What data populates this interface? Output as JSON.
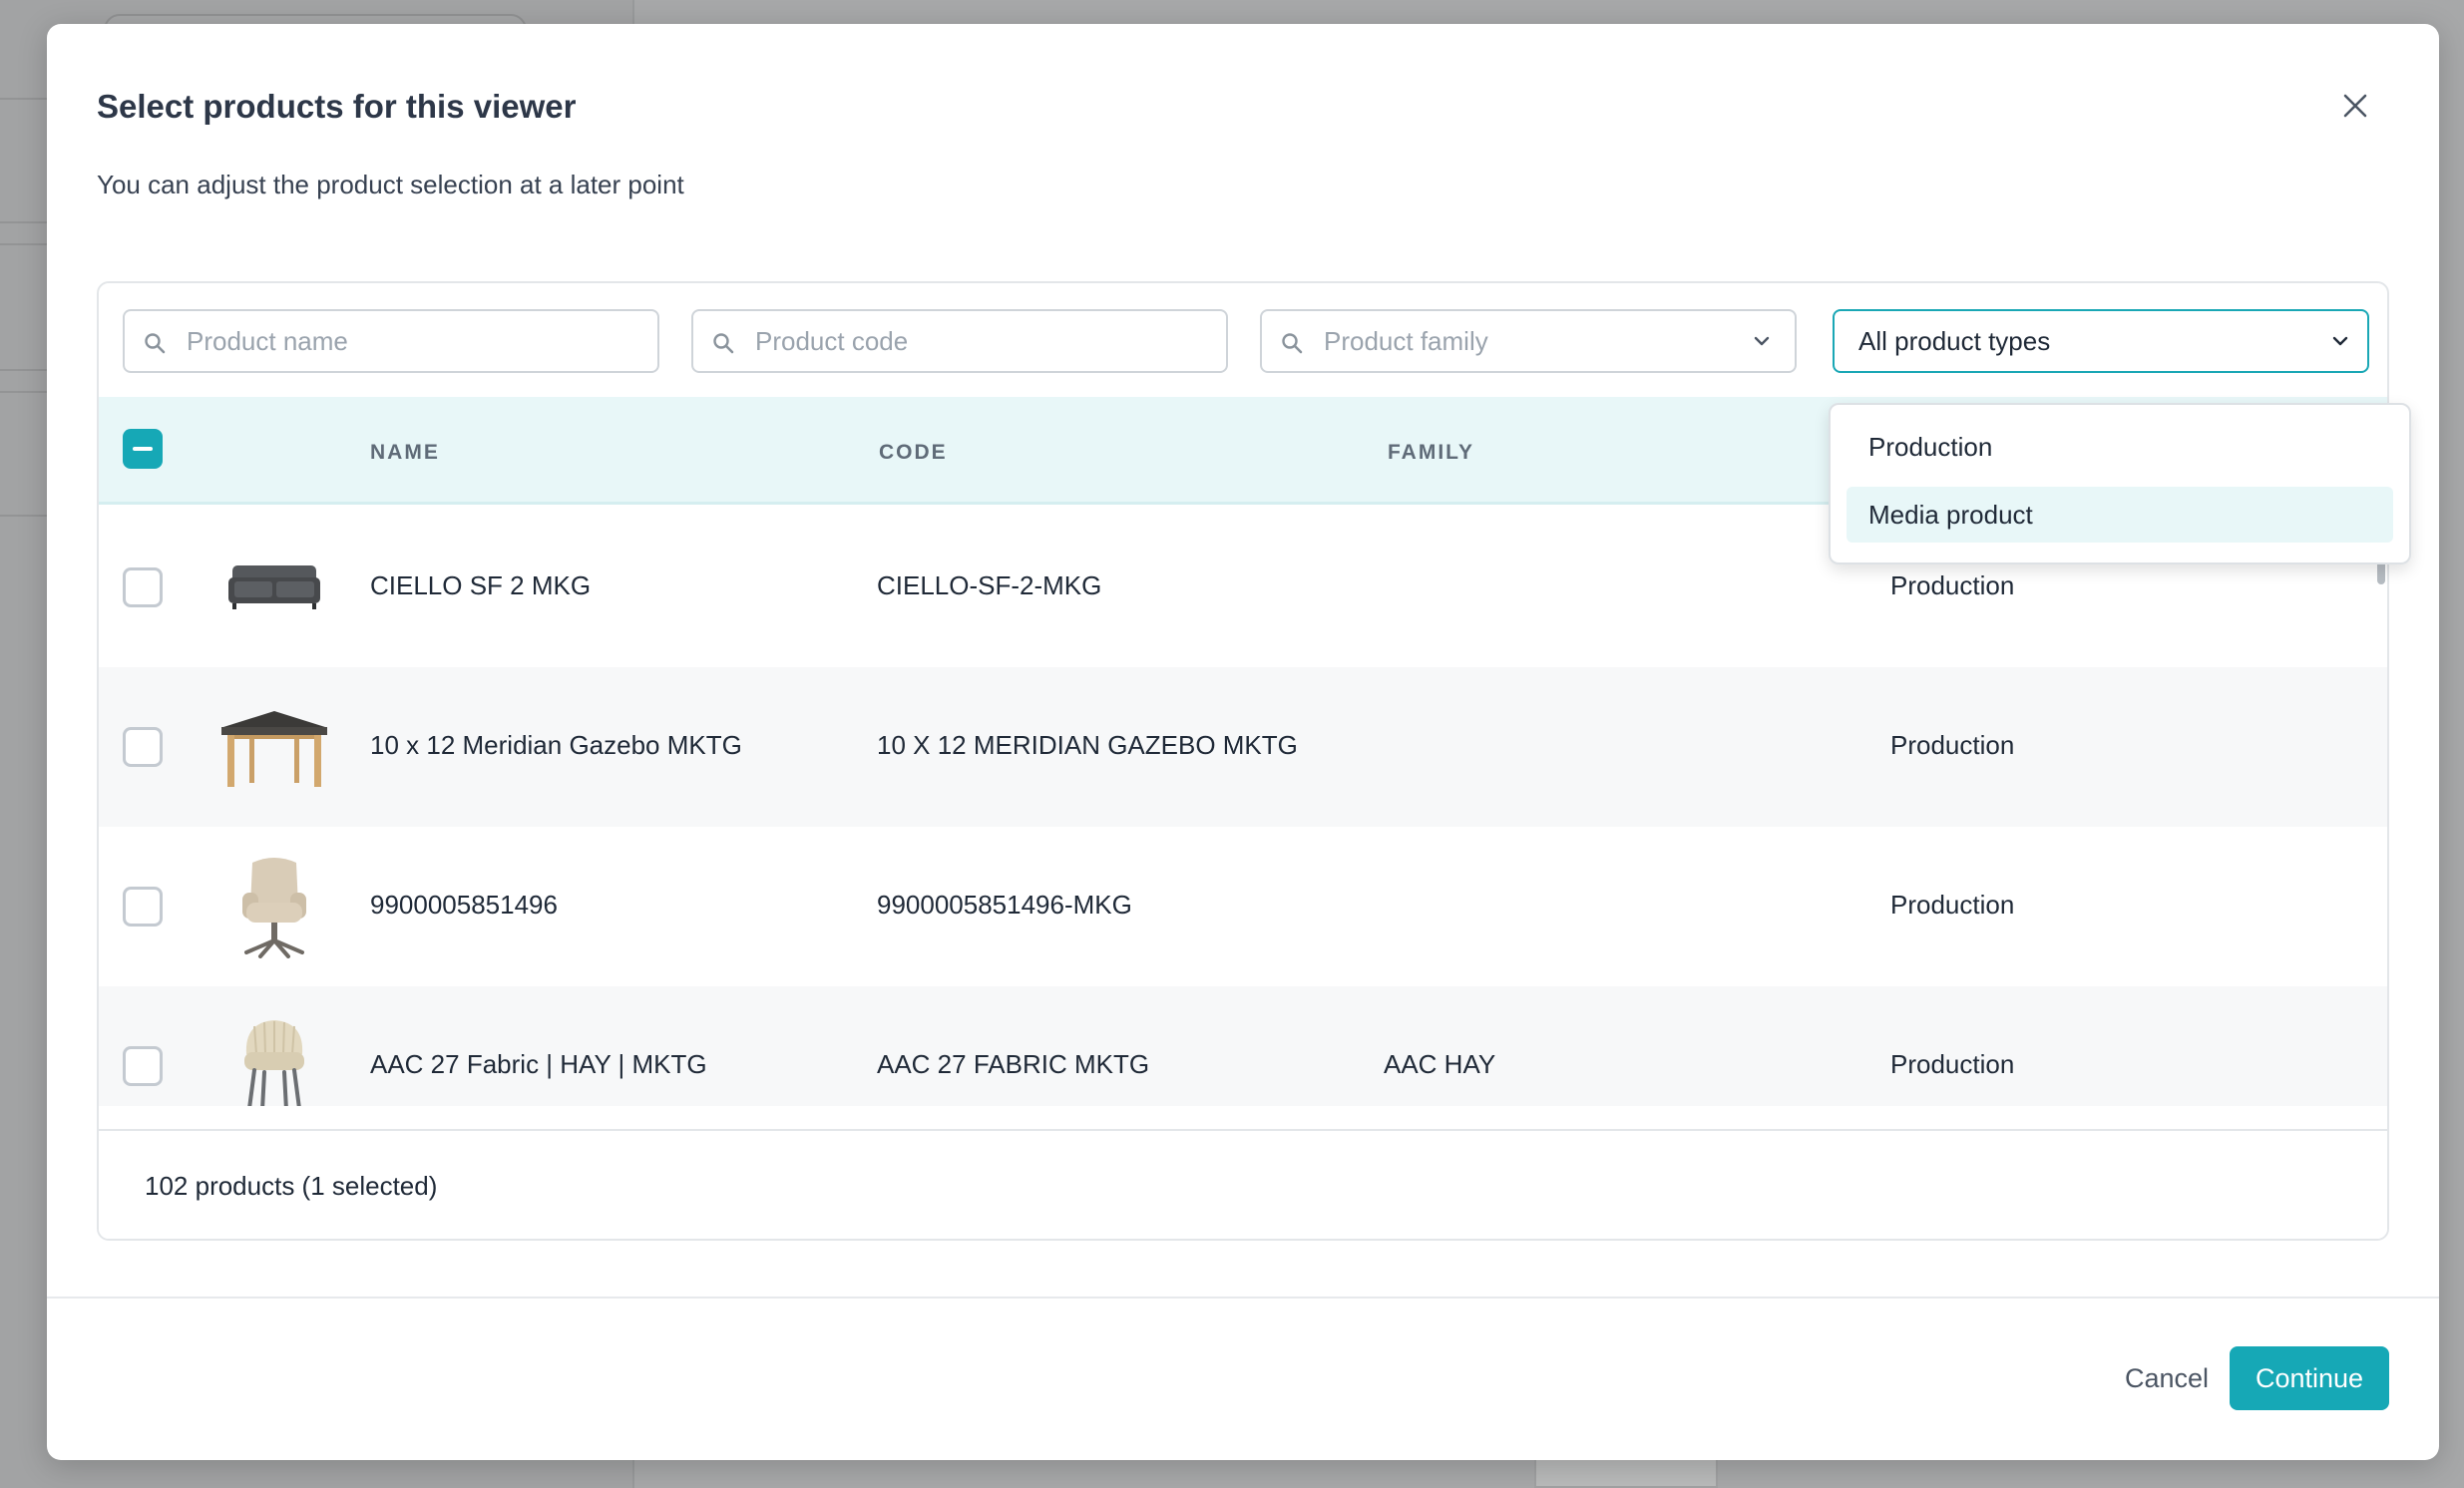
{
  "dialog": {
    "title": "Select products for this viewer",
    "subtitle": "You can adjust the product selection at a later point"
  },
  "filters": {
    "product_name_placeholder": "Product name",
    "product_code_placeholder": "Product code",
    "product_family_placeholder": "Product family",
    "product_type_selected": "All product types"
  },
  "type_menu": {
    "options": [
      "Production",
      "Media product"
    ],
    "highlighted": "Media product"
  },
  "table": {
    "headers": {
      "name": "NAME",
      "code": "CODE",
      "family": "FAMILY"
    },
    "rows": [
      {
        "thumbnail": "sofa",
        "name": "CIELLO SF 2 MKG",
        "code": "CIELLO-SF-2-MKG",
        "family": "",
        "type": "Production",
        "selected": false
      },
      {
        "thumbnail": "gazebo",
        "name": "10 x 12 Meridian Gazebo MKTG",
        "code": "10 X 12 MERIDIAN GAZEBO MKTG",
        "family": "",
        "type": "Production",
        "selected": false
      },
      {
        "thumbnail": "lounge-chair",
        "name": "9900005851496",
        "code": "9900005851496-MKG",
        "family": "",
        "type": "Production",
        "selected": false
      },
      {
        "thumbnail": "dining-chair",
        "name": "AAC 27 Fabric | HAY | MKTG",
        "code": "AAC 27 FABRIC MKTG",
        "family": "AAC HAY",
        "type": "Production",
        "selected": false
      }
    ],
    "summary": "102 products (1 selected)"
  },
  "actions": {
    "cancel_label": "Cancel",
    "continue_label": "Continue"
  },
  "colors": {
    "accent": "#16a8b6",
    "header_background": "#e8f7f8",
    "overlay": "#a7a8a9"
  }
}
